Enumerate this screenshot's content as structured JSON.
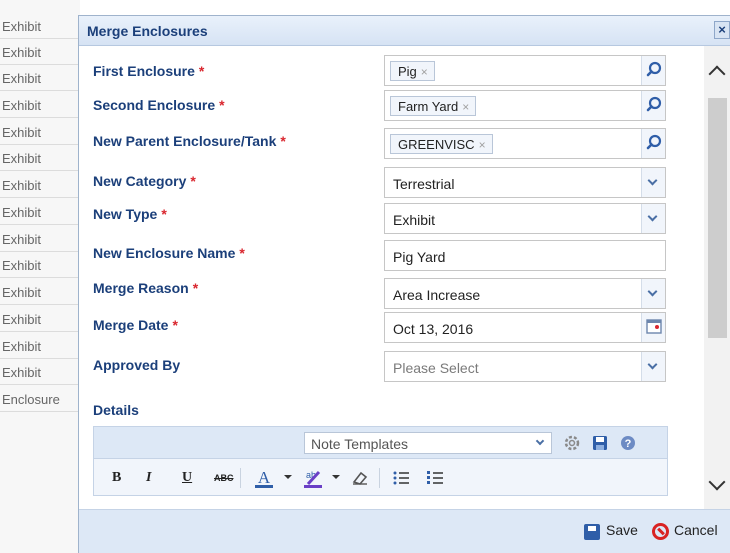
{
  "background_list": {
    "rows": [
      "Exhibit",
      "Exhibit",
      "Exhibit",
      "Exhibit",
      "Exhibit",
      "Exhibit",
      "Exhibit",
      "Exhibit",
      "Exhibit",
      "Exhibit",
      "Exhibit",
      "Exhibit",
      "Exhibit",
      "Exhibit",
      "Enclosure"
    ]
  },
  "dialog": {
    "title": "Merge Enclosures",
    "close_label": "×"
  },
  "form": {
    "required_marker": "*",
    "first_enclosure": {
      "label": "First Enclosure",
      "token": "Pig",
      "token_remove": "×",
      "icon": "search-icon"
    },
    "second_enclosure": {
      "label": "Second Enclosure",
      "token": "Farm Yard",
      "token_remove": "×",
      "icon": "search-icon"
    },
    "new_parent": {
      "label": "New Parent Enclosure/Tank",
      "token": "GREENVISC",
      "token_remove": "×",
      "icon": "search-icon"
    },
    "new_category": {
      "label": "New Category",
      "value": "Terrestrial"
    },
    "new_type": {
      "label": "New Type",
      "value": "Exhibit"
    },
    "new_enclosure_name": {
      "label": "New Enclosure Name",
      "value": "Pig Yard"
    },
    "merge_reason": {
      "label": "Merge Reason",
      "value": "Area Increase"
    },
    "merge_date": {
      "label": "Merge Date",
      "value": "Oct 13, 2016",
      "icon": "calendar-icon"
    },
    "approved_by": {
      "label": "Approved By",
      "placeholder": "Please Select"
    },
    "details": {
      "label": "Details"
    }
  },
  "editor": {
    "note_templates": "Note Templates",
    "toolbar": {
      "bold": "B",
      "italic": "I",
      "underline": "U",
      "strike": "ABC"
    }
  },
  "footer": {
    "save_label": "Save",
    "cancel_label": "Cancel"
  },
  "colors": {
    "label_blue": "#1b3f7a",
    "required_red": "#d9262e",
    "header_bg": "#dde8f6"
  }
}
